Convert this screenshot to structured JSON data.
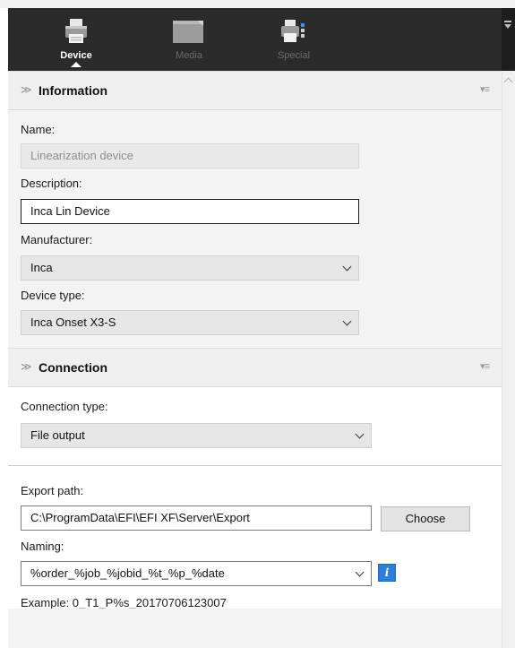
{
  "toolbar": {
    "tabs": [
      {
        "label": "Device",
        "icon": "printer-icon",
        "active": true
      },
      {
        "label": "Media",
        "icon": "media-sheet-icon",
        "active": false
      },
      {
        "label": "Special",
        "icon": "special-printer-icon",
        "active": false
      }
    ]
  },
  "information": {
    "title": "Information",
    "name_label": "Name:",
    "name_value": "Linearization device",
    "description_label": "Description:",
    "description_value": "Inca Lin Device",
    "manufacturer_label": "Manufacturer:",
    "manufacturer_value": "Inca",
    "device_type_label": "Device type:",
    "device_type_value": "Inca Onset X3-S"
  },
  "connection": {
    "title": "Connection",
    "type_label": "Connection type:",
    "type_value": "File output",
    "export_label": "Export path:",
    "export_value": "C:\\ProgramData\\EFI\\EFI XF\\Server\\Export",
    "choose_label": "Choose",
    "naming_label": "Naming:",
    "naming_value": "%order_%job_%jobid_%t_%p_%date",
    "info_glyph": "i",
    "example_text": "Example: 0_T1_P%s_20170706123007"
  },
  "colors": {
    "toolbar_bg": "#2b2b2b",
    "section_header_bg": "#efefef",
    "info_accent": "#2f7fd8"
  }
}
